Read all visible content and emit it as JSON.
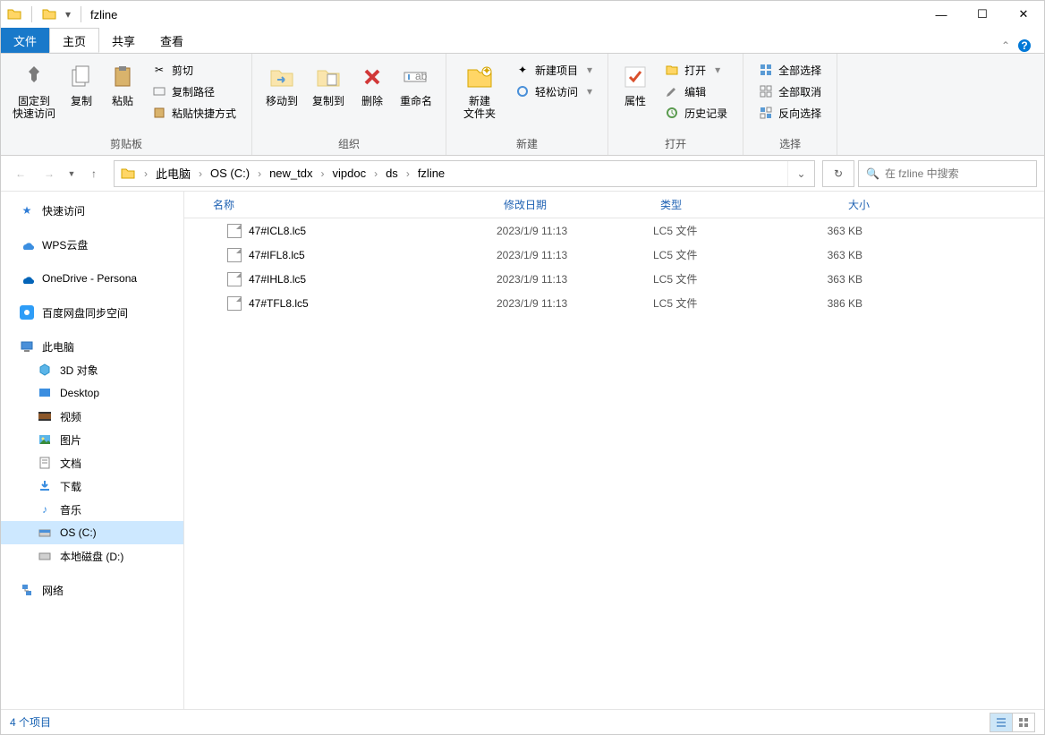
{
  "title": "fzline",
  "tabs": {
    "file": "文件",
    "home": "主页",
    "share": "共享",
    "view": "查看"
  },
  "ribbon": {
    "clipboard": {
      "label": "剪贴板",
      "pin": "固定到\n快速访问",
      "copy": "复制",
      "paste": "粘贴",
      "cut": "剪切",
      "copypath": "复制路径",
      "pasteshortcut": "粘贴快捷方式"
    },
    "organize": {
      "label": "组织",
      "moveto": "移动到",
      "copyto": "复制到",
      "del": "删除",
      "rename": "重命名"
    },
    "newg": {
      "label": "新建",
      "newfolder": "新建\n文件夹",
      "newitem": "新建项目",
      "easyaccess": "轻松访问"
    },
    "openg": {
      "label": "打开",
      "properties": "属性",
      "open": "打开",
      "edit": "编辑",
      "history": "历史记录"
    },
    "selectg": {
      "label": "选择",
      "selectall": "全部选择",
      "selectnone": "全部取消",
      "invert": "反向选择"
    }
  },
  "breadcrumb": [
    "此电脑",
    "OS (C:)",
    "new_tdx",
    "vipdoc",
    "ds",
    "fzline"
  ],
  "search_placeholder": "在 fzline 中搜索",
  "columns": {
    "name": "名称",
    "date": "修改日期",
    "type": "类型",
    "size": "大小"
  },
  "files": [
    {
      "name": "47#ICL8.lc5",
      "date": "2023/1/9 11:13",
      "type": "LC5 文件",
      "size": "363 KB"
    },
    {
      "name": "47#IFL8.lc5",
      "date": "2023/1/9 11:13",
      "type": "LC5 文件",
      "size": "363 KB"
    },
    {
      "name": "47#IHL8.lc5",
      "date": "2023/1/9 11:13",
      "type": "LC5 文件",
      "size": "363 KB"
    },
    {
      "name": "47#TFL8.lc5",
      "date": "2023/1/9 11:13",
      "type": "LC5 文件",
      "size": "386 KB"
    }
  ],
  "nav": {
    "quickaccess": "快速访问",
    "wps": "WPS云盘",
    "onedrive": "OneDrive - Persona",
    "baidu": "百度网盘同步空间",
    "thispc": "此电脑",
    "d3d": "3D 对象",
    "desktop": "Desktop",
    "videos": "视频",
    "pictures": "图片",
    "docs": "文档",
    "downloads": "下载",
    "music": "音乐",
    "osc": "OS (C:)",
    "diskd": "本地磁盘 (D:)",
    "network": "网络"
  },
  "status": "4 个项目"
}
